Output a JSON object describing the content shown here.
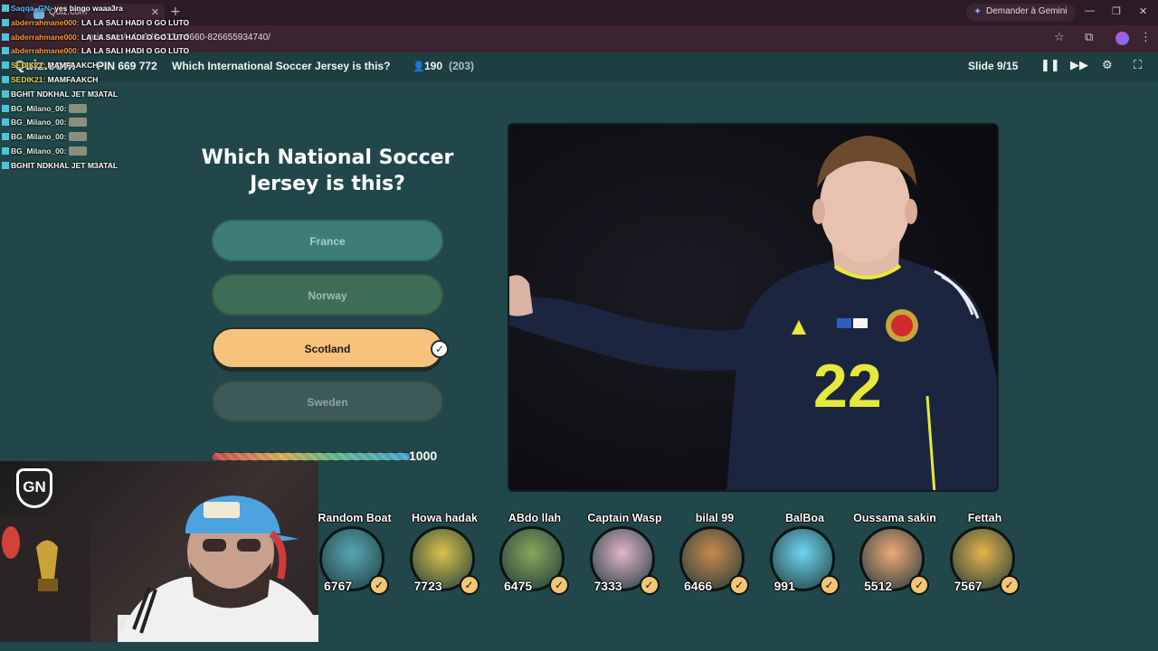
{
  "browser": {
    "tab_title": "Quiz.com",
    "gemini_label": "Demander à Gemini",
    "url": "quiz.com/.../...6d6-433e-8660-826655934740/"
  },
  "quiz": {
    "logo": "Quiz.com",
    "pin": "PIN 669 772",
    "header_title": "Which International Soccer Jersey is this?",
    "player_count": "190",
    "player_total": "(203)",
    "slide": "Slide 9/15"
  },
  "question": "Which National Soccer Jersey is this?",
  "answers": [
    {
      "label": "France"
    },
    {
      "label": "Norway"
    },
    {
      "label": "Scotland"
    },
    {
      "label": "Sweden"
    }
  ],
  "points": "1000",
  "timer_fraction": 1.0,
  "chat": [
    {
      "user": "Saqqa_GN",
      "user_color": "#4fc3ff",
      "msg": "yes bingo waaa3ra"
    },
    {
      "user": "abderrahmane000",
      "user_color": "#ff9b3d",
      "msg": "LA LA SALI HADI O GO LUTO"
    },
    {
      "user": "abderrahmane000",
      "user_color": "#ff9b3d",
      "msg": "LA LA SALI HADI O GO LUTO"
    },
    {
      "user": "abderrahmane000",
      "user_color": "#ff9b3d",
      "msg": "LA LA SALI HADI O GO LUTO"
    },
    {
      "user": "SEDIK21",
      "user_color": "#e8d84a",
      "msg": "MAMFAAKCH"
    },
    {
      "user": "SEDIK21",
      "user_color": "#e8d84a",
      "msg": "MAMFAAKCH"
    },
    {
      "user": "",
      "user_color": "#ff4040",
      "msg": "BGHIT NDKHAL JET M3ATAL"
    },
    {
      "user": "BG_Milano_00",
      "user_color": "#e8f0e8",
      "msg": ""
    },
    {
      "user": "BG_Milano_00",
      "user_color": "#e8f0e8",
      "msg": ""
    },
    {
      "user": "BG_Milano_00",
      "user_color": "#e8f0e8",
      "msg": ""
    },
    {
      "user": "BG_Milano_00",
      "user_color": "#e8f0e8",
      "msg": ""
    },
    {
      "user": "",
      "user_color": "#ff4040",
      "msg": "BGHIT NDKHAL JET M3ATAL"
    }
  ],
  "players": [
    {
      "name": "Random Boat",
      "score": "6767",
      "color": "#57a7b5"
    },
    {
      "name": "Howa hadak",
      "score": "7723",
      "color": "#d9c24b"
    },
    {
      "name": "ABdo llah",
      "score": "6475",
      "color": "#8aa65a"
    },
    {
      "name": "Captain Wasp",
      "score": "7333",
      "color": "#e3b5c8"
    },
    {
      "name": "bilal 99",
      "score": "6466",
      "color": "#c98a4d"
    },
    {
      "name": "BalBoa",
      "score": "991",
      "color": "#6fd6f0"
    },
    {
      "name": "Oussama sakin",
      "score": "5512",
      "color": "#f0a978"
    },
    {
      "name": "Fettah",
      "score": "7567",
      "color": "#e6b34a"
    }
  ],
  "photo": {
    "jersey_number": "22",
    "jersey_color": "#1b2540",
    "trim_color": "#e6e93a"
  }
}
